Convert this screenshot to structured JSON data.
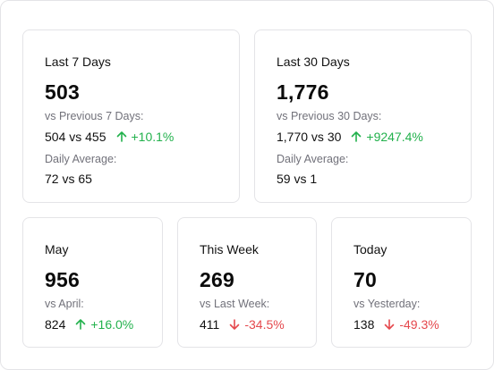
{
  "colors": {
    "up": "#22b14c",
    "down": "#e5484d"
  },
  "cards": {
    "last7": {
      "title": "Last 7 Days",
      "value": "503",
      "compare_label": "vs Previous 7 Days:",
      "compare_values": "504 vs 455",
      "trend": "up",
      "change": "+10.1%",
      "average_label": "Daily Average:",
      "average_values": "72 vs 65"
    },
    "last30": {
      "title": "Last 30 Days",
      "value": "1,776",
      "compare_label": "vs Previous 30 Days:",
      "compare_values": "1,770 vs 30",
      "trend": "up",
      "change": "+9247.4%",
      "average_label": "Daily Average:",
      "average_values": "59 vs 1"
    },
    "month": {
      "title": "May",
      "value": "956",
      "compare_label": "vs April:",
      "compare_values": "824",
      "trend": "up",
      "change": "+16.0%"
    },
    "week": {
      "title": "This Week",
      "value": "269",
      "compare_label": "vs Last Week:",
      "compare_values": "411",
      "trend": "down",
      "change": "-34.5%"
    },
    "today": {
      "title": "Today",
      "value": "70",
      "compare_label": "vs Yesterday:",
      "compare_values": "138",
      "trend": "down",
      "change": "-49.3%"
    }
  }
}
